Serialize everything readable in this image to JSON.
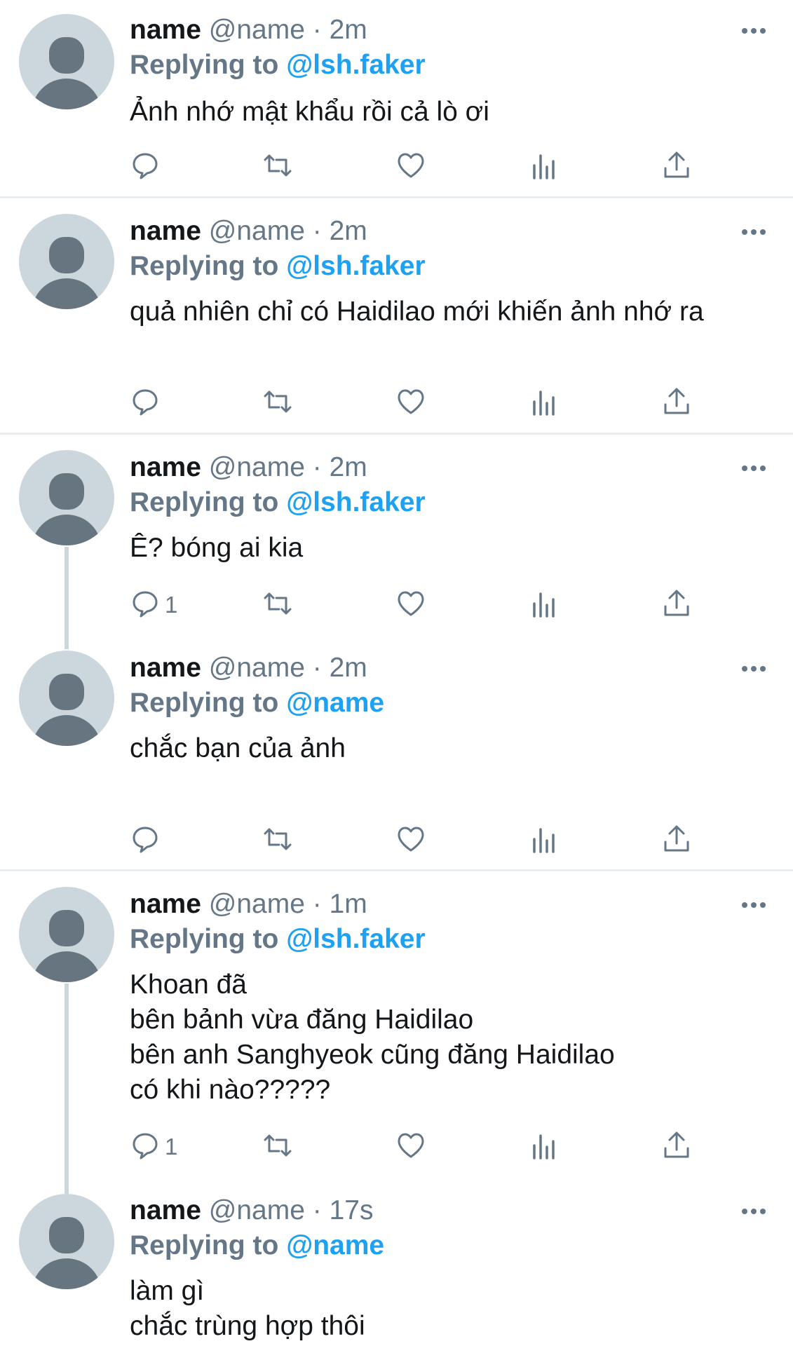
{
  "tweets": [
    {
      "name": "name",
      "handle": "@name",
      "time": "2m",
      "replying_label": "Replying to",
      "replying_to": "@lsh.faker",
      "text": "Ảnh nhớ mật khẩu rồi cả lò ơi",
      "reply_count": ""
    },
    {
      "name": "name",
      "handle": "@name",
      "time": "2m",
      "replying_label": "Replying to",
      "replying_to": "@lsh.faker",
      "text": "quả nhiên chỉ có Haidilao mới khiến ảnh nhớ ra",
      "reply_count": ""
    },
    {
      "name": "name",
      "handle": "@name",
      "time": "2m",
      "replying_label": "Replying to",
      "replying_to": "@lsh.faker",
      "text": "Ê? bóng ai kia",
      "reply_count": "1"
    },
    {
      "name": "name",
      "handle": "@name",
      "time": "2m",
      "replying_label": "Replying to",
      "replying_to": "@name",
      "text": "chắc bạn của ảnh",
      "reply_count": ""
    },
    {
      "name": "name",
      "handle": "@name",
      "time": "1m",
      "replying_label": "Replying to",
      "replying_to": "@lsh.faker",
      "text": "Khoan đã\nbên bảnh vừa đăng Haidilao\nbên anh Sanghyeok cũng đăng Haidilao\ncó khi nào?????",
      "reply_count": "1"
    },
    {
      "name": "name",
      "handle": "@name",
      "time": "17s",
      "replying_label": "Replying to",
      "replying_to": "@name",
      "text": "làm gì\nchắc trùng hợp thôi",
      "reply_count": ""
    }
  ],
  "separator": "·",
  "icons": {
    "reply": "reply-icon",
    "retweet": "retweet-icon",
    "like": "heart-icon",
    "analytics": "analytics-icon",
    "share": "share-icon",
    "more": "more-icon"
  },
  "colors": {
    "link": "#1da1f2",
    "secondary": "#657786",
    "avatar_bg": "#ccd6dd"
  }
}
